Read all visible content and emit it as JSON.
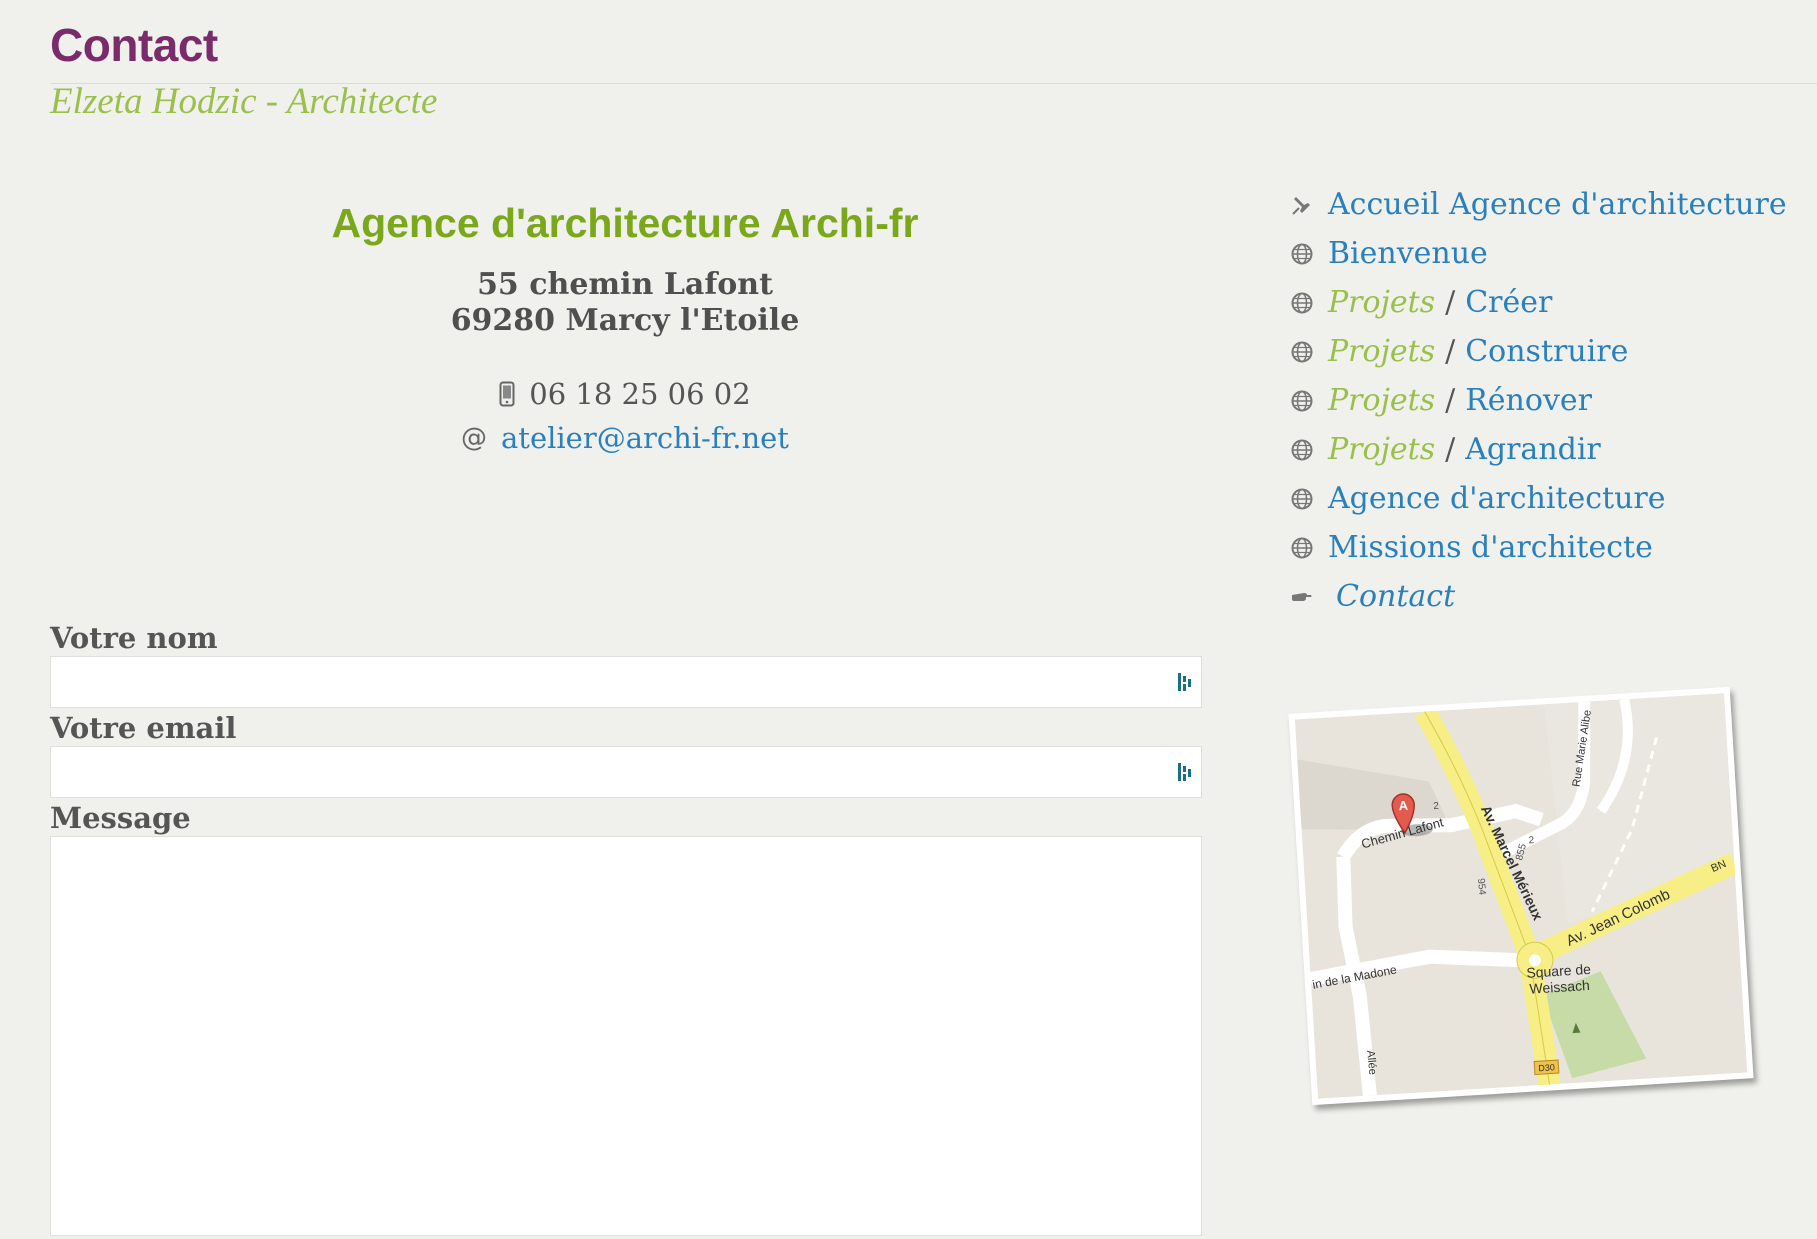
{
  "header": {
    "title": "Contact",
    "subtitle": "Elzeta Hodzic - Architecte"
  },
  "agency": {
    "name": "Agence d'architecture Archi-fr",
    "address_line1": "55 chemin Lafont",
    "address_line2": "69280 Marcy l'Etoile",
    "phone": "06 18 25 06 02",
    "email": "atelier@archi-fr.net",
    "email_icon": "at-sign-icon",
    "phone_icon": "mobile-phone-icon"
  },
  "form": {
    "name_label": "Votre nom",
    "email_label": "Votre email",
    "message_label": "Message",
    "name_value": "",
    "email_value": "",
    "message_value": ""
  },
  "nav": {
    "items": [
      {
        "label": "Accueil Agence d'architecture",
        "icon": "pin-icon"
      },
      {
        "label": "Bienvenue",
        "icon": "globe-icon"
      },
      {
        "crumb": "Projets",
        "separator": "/",
        "label": "Créer",
        "icon": "globe-icon"
      },
      {
        "crumb": "Projets",
        "separator": "/",
        "label": "Construire",
        "icon": "globe-icon"
      },
      {
        "crumb": "Projets",
        "separator": "/",
        "label": "Rénover",
        "icon": "globe-icon"
      },
      {
        "crumb": "Projets",
        "separator": "/",
        "label": "Agrandir",
        "icon": "globe-icon"
      },
      {
        "label": "Agence d'architecture",
        "icon": "globe-icon"
      },
      {
        "label": "Missions d'architecte",
        "icon": "globe-icon"
      },
      {
        "label": "Contact",
        "icon": "pointing-hand-icon",
        "current": true
      }
    ]
  },
  "map": {
    "marker": "A",
    "labels": {
      "chemin_lafont": "Chemin Lafont",
      "av_marcel_merieux": "Av. Marcel Mérieux",
      "rue_marie_alibe": "Rue Marie Alibe",
      "av_jean_colomb": "Av. Jean Colomb",
      "square_line1": "Square de",
      "square_line2": "Weissach",
      "madone": "in de la Madone",
      "allee": "Allée",
      "num_954": "954",
      "num_855": "855",
      "num_2a": "2",
      "num_2b": "2",
      "bn": "BN",
      "d30": "D30"
    }
  },
  "colors": {
    "background": "#f0f0ec",
    "title": "#7a2c6a",
    "accent_green": "#9bbf4b",
    "agency_green": "#7aa81a",
    "link_blue": "#2a7fbd",
    "text_gray": "#555555"
  }
}
